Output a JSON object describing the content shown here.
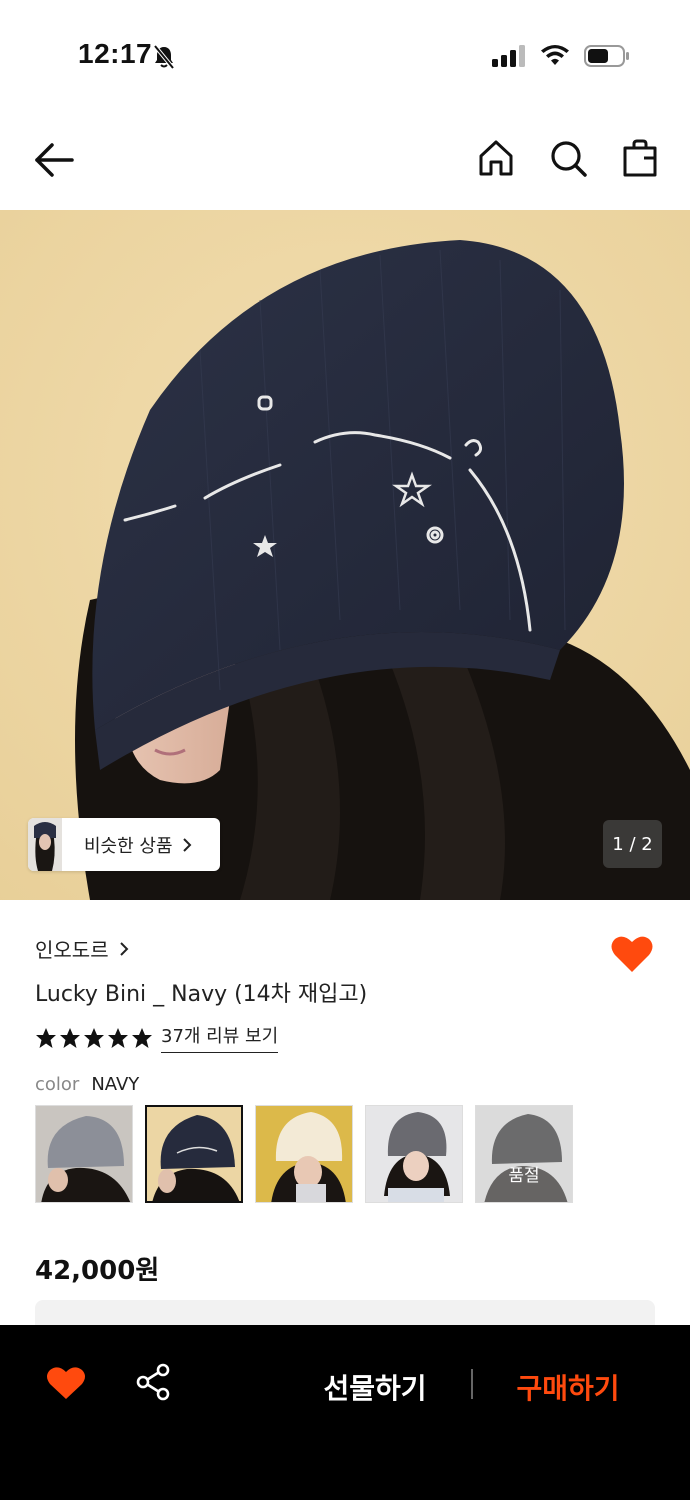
{
  "status_bar": {
    "time": "12:17"
  },
  "nav": {
    "back_icon": "arrow-left-icon",
    "home_icon": "home-icon",
    "search_icon": "search-icon",
    "bag_icon": "shopping-bag-icon"
  },
  "hero": {
    "similar_label": "비슷한 상품",
    "page_indicator": "1 / 2"
  },
  "product": {
    "brand": "인오도르",
    "title": "Lucky Bini _ Navy (14차 재입고)",
    "rating_stars": 5,
    "review_link": "37개 리뷰 보기",
    "color_label": "color",
    "color_value": "NAVY",
    "swatches": [
      {
        "color": "gray",
        "selected": false,
        "sold_out": false
      },
      {
        "color": "navy",
        "selected": true,
        "sold_out": false
      },
      {
        "color": "ivory",
        "selected": false,
        "sold_out": false
      },
      {
        "color": "charcoal",
        "selected": false,
        "sold_out": false
      },
      {
        "color": "black",
        "selected": false,
        "sold_out": true,
        "sold_out_label": "품절"
      }
    ],
    "price": "42,000원"
  },
  "bottom_bar": {
    "gift_label": "선물하기",
    "buy_label": "구매하기"
  },
  "colors": {
    "accent": "#ff4a0e",
    "bottom_bar_bg": "#000000",
    "hero_bg": "#efd9a6"
  }
}
